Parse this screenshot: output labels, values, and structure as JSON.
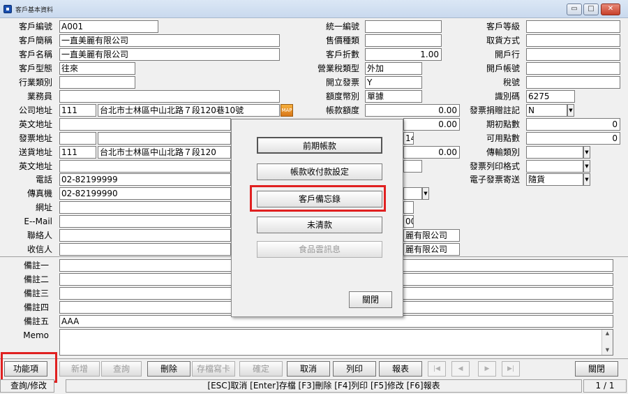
{
  "window": {
    "title": "客戶基本資料"
  },
  "left_labels": [
    "客戶編號",
    "客戶簡稱",
    "客戶名稱",
    "客戶型態",
    "行業類別",
    "業務員",
    "公司地址",
    "英文地址",
    "發票地址",
    "送貨地址",
    "英文地址",
    "電話",
    "傳真機",
    "網址",
    "E--Mail",
    "聯絡人",
    "收信人"
  ],
  "left_values": {
    "customer_no": "A001",
    "short_name": "一直美麗有限公司",
    "full_name": "一直美麗有限公司",
    "customer_type": "往來",
    "company_zip": "111",
    "company_addr": "台北市士林區中山北路７段120巷10號",
    "delivery_zip": "111",
    "delivery_addr": "台北市士林區中山北路７段120",
    "phone": "02-82199999",
    "fax": "02-82199990",
    "map_label": "MAP"
  },
  "mid_labels": [
    "統一編號",
    "售價種類",
    "客戶折數",
    "營業稅類型",
    "開立發票",
    "額度幣別",
    "帳款額度"
  ],
  "mid_values": {
    "discount": "1.00",
    "tax_type": "外加",
    "invoice": "Y",
    "currency": "單據",
    "credit_limit": "0.00",
    "hidden_a": "0.00",
    "hidden_b": "14",
    "hidden_c": "0.00",
    "hidden_d": "00",
    "contact_partial": "麗有限公司",
    "receiver_partial": "麗有限公司"
  },
  "right_labels": [
    "客戶等級",
    "取貨方式",
    "開戶行",
    "開戶帳號",
    "稅號",
    "識別碼",
    "發票捐贈註記",
    "期初點數",
    "可用點數",
    "傳輸類別",
    "發票列印格式",
    "電子發票寄送"
  ],
  "right_values": {
    "id_code": "6275",
    "donation": "N",
    "initial_points": "0",
    "available_points": "0",
    "email_invoice": "隨貨"
  },
  "notes": {
    "labels": [
      "備註一",
      "備註二",
      "備註三",
      "備註四",
      "備註五",
      "Memo"
    ],
    "note5": "AAA"
  },
  "dialog": {
    "buttons": [
      "前期帳款",
      "帳款收付款設定",
      "客戶備忘錄",
      "未清款",
      "食品雲訊息"
    ],
    "close": "關閉"
  },
  "toolbar": {
    "functions": "功能項",
    "new": "新增",
    "query": "查詢",
    "delete": "刪除",
    "save_card": "存檔寫卡",
    "confirm": "確定",
    "cancel": "取消",
    "print": "列印",
    "report": "報表",
    "close": "關閉"
  },
  "status": {
    "mode": "查詢/修改",
    "shortcuts": "[ESC]取消 [Enter]存檔 [F3]刪除 [F4]列印 [F5]修改 [F6]報表",
    "page": "1 / 1"
  },
  "highlight_color": "#e02020"
}
